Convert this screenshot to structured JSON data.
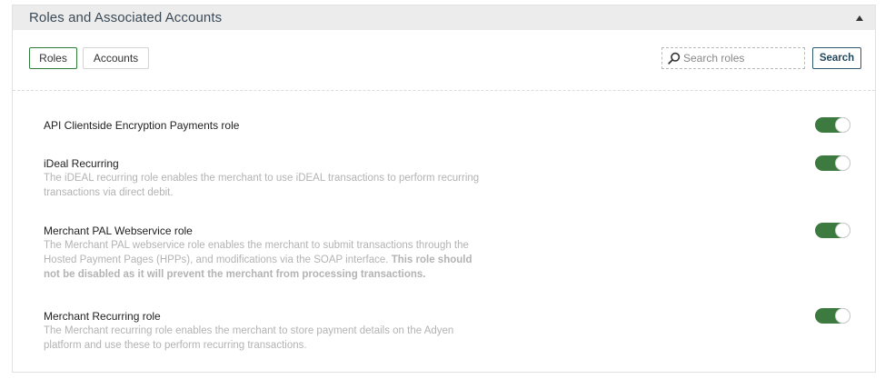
{
  "panel": {
    "title": "Roles and Associated Accounts"
  },
  "tabs": {
    "roles_label": "Roles",
    "accounts_label": "Accounts"
  },
  "search": {
    "placeholder": "Search roles",
    "value": "",
    "button_label": "Search"
  },
  "roles": [
    {
      "name": "API Clientside Encryption Payments role",
      "description": "",
      "enabled": true
    },
    {
      "name": "iDeal Recurring",
      "description": "The iDEAL recurring role enables the merchant to use iDEAL transactions to perform recurring transactions via direct debit.",
      "enabled": true
    },
    {
      "name": "Merchant PAL Webservice role",
      "description": "The Merchant PAL webservice role enables the merchant to submit transactions through the Hosted Payment Pages (HPPs), and modifications via the SOAP interface.",
      "warning": "This role should not be disabled as it will prevent the merchant from processing transactions.",
      "enabled": true
    },
    {
      "name": "Merchant Recurring role",
      "description": "The Merchant recurring role enables the merchant to store payment details on the Adyen platform and use these to perform recurring transactions.",
      "enabled": true
    }
  ],
  "colors": {
    "toggle_on": "#3c7a3f",
    "active_tab_border": "#2e7d3a",
    "search_button_border": "#2f5a6e",
    "header_bg": "#ececec"
  },
  "icons": {
    "collapse": "caret-up-icon",
    "search": "magnifier-icon"
  }
}
